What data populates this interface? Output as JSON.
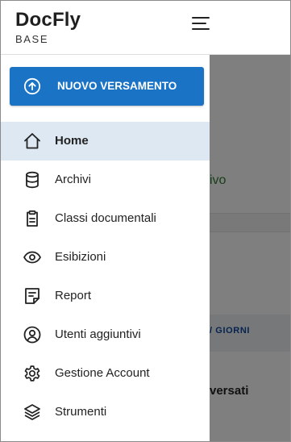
{
  "header": {
    "brand": "DocFly",
    "subtitle": "BASE",
    "menu_icon": "hamburger-menu-icon"
  },
  "drawer": {
    "cta_label": "NUOVO VERSAMENTO",
    "cta_icon": "arrow-up-circle-icon",
    "items": [
      {
        "label": "Home",
        "icon": "home-icon",
        "active": true
      },
      {
        "label": "Archivi",
        "icon": "database-icon",
        "active": false
      },
      {
        "label": "Classi documentali",
        "icon": "clipboard-icon",
        "active": false
      },
      {
        "label": "Esibizioni",
        "icon": "eye-icon",
        "active": false
      },
      {
        "label": "Report",
        "icon": "report-icon",
        "active": false
      },
      {
        "label": "Utenti aggiuntivi",
        "icon": "user-circle-icon",
        "active": false
      },
      {
        "label": "Gestione Account",
        "icon": "gear-icon",
        "active": false
      },
      {
        "label": "Strumenti",
        "icon": "layers-icon",
        "active": false
      }
    ]
  },
  "background": {
    "text1": "ivo",
    "text2": "/ GIORNI",
    "text3": "versati"
  },
  "colors": {
    "primary": "#1a73c4",
    "active_item_bg": "#dde8f3",
    "overlay": "rgba(0,0,0,0.5)"
  }
}
